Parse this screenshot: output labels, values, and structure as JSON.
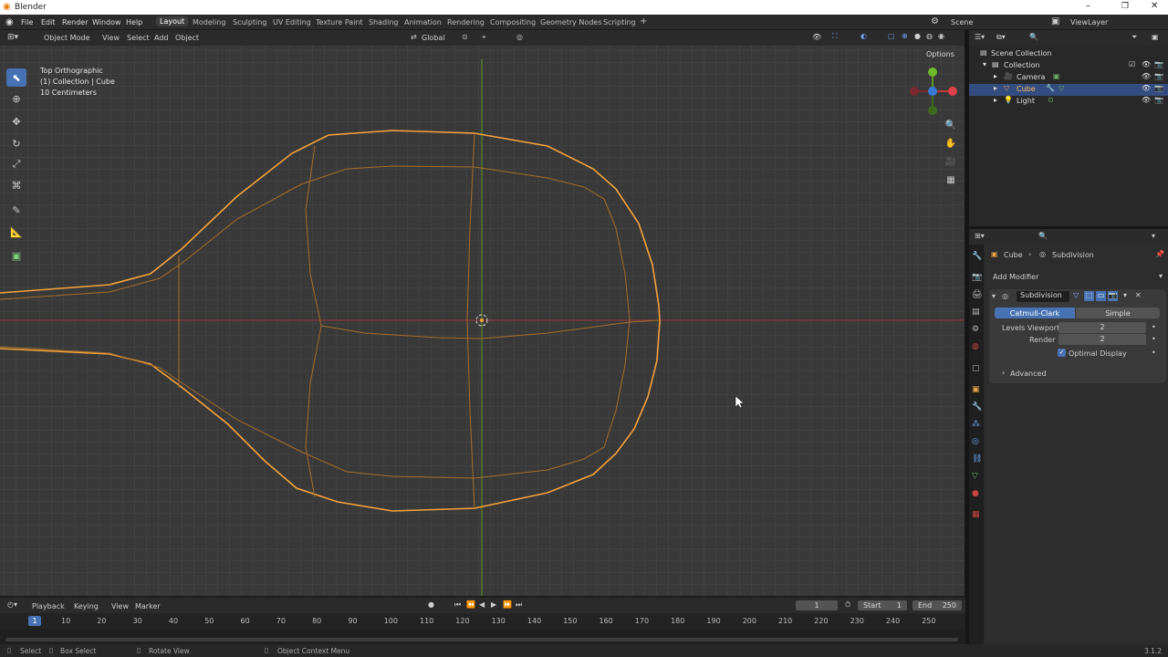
{
  "window": {
    "title": "Blender"
  },
  "menu": [
    "File",
    "Edit",
    "Render",
    "Window",
    "Help"
  ],
  "workspaces": [
    "Layout",
    "Modeling",
    "Sculpting",
    "UV Editing",
    "Texture Paint",
    "Shading",
    "Animation",
    "Rendering",
    "Compositing",
    "Geometry Nodes",
    "Scripting"
  ],
  "active_workspace": "Layout",
  "scene": {
    "scene_name": "Scene",
    "view_layer": "ViewLayer"
  },
  "viewport_header": {
    "mode": "Object Mode",
    "menus": [
      "View",
      "Select",
      "Add",
      "Object"
    ],
    "transform": "Global",
    "options": "Options"
  },
  "viewport_overlay": {
    "view_name": "Top Orthographic",
    "context": "(1) Collection | Cube",
    "scale": "10 Centimeters"
  },
  "outliner": {
    "root": "Scene Collection",
    "collection": "Collection",
    "items": [
      {
        "name": "Camera",
        "icon": "camera-icon"
      },
      {
        "name": "Cube",
        "icon": "mesh-icon",
        "selected": true
      },
      {
        "name": "Light",
        "icon": "light-icon"
      }
    ]
  },
  "properties": {
    "breadcrumb_object": "Cube",
    "breadcrumb_modifier": "Subdivision",
    "add_modifier": "Add Modifier",
    "modifier_name": "Subdivision",
    "type_options": [
      "Catmull-Clark",
      "Simple"
    ],
    "selected_type": "Catmull-Clark",
    "levels_viewport_label": "Levels Viewport",
    "levels_viewport_value": "2",
    "render_label": "Render",
    "render_value": "2",
    "optimal_display": "Optimal Display",
    "advanced": "Advanced"
  },
  "timeline": {
    "menus": [
      "Playback",
      "Keying",
      "View",
      "Marker"
    ],
    "current_frame": "1",
    "start_label": "Start",
    "start": "1",
    "end_label": "End",
    "end": "250",
    "ruler": [
      "1",
      "10",
      "20",
      "30",
      "40",
      "50",
      "60",
      "70",
      "80",
      "90",
      "100",
      "110",
      "120",
      "130",
      "140",
      "150",
      "160",
      "170",
      "180",
      "190",
      "200",
      "210",
      "220",
      "230",
      "240",
      "250"
    ]
  },
  "status": {
    "select": "Select",
    "box_select": "Box Select",
    "rotate_view": "Rotate View",
    "context_menu": "Object Context Menu",
    "version": "3.1.2"
  },
  "colors": {
    "accent": "#4772b3",
    "selection": "#f5a33c",
    "x_axis": "#a0383c",
    "y_axis": "#5d9b29"
  }
}
